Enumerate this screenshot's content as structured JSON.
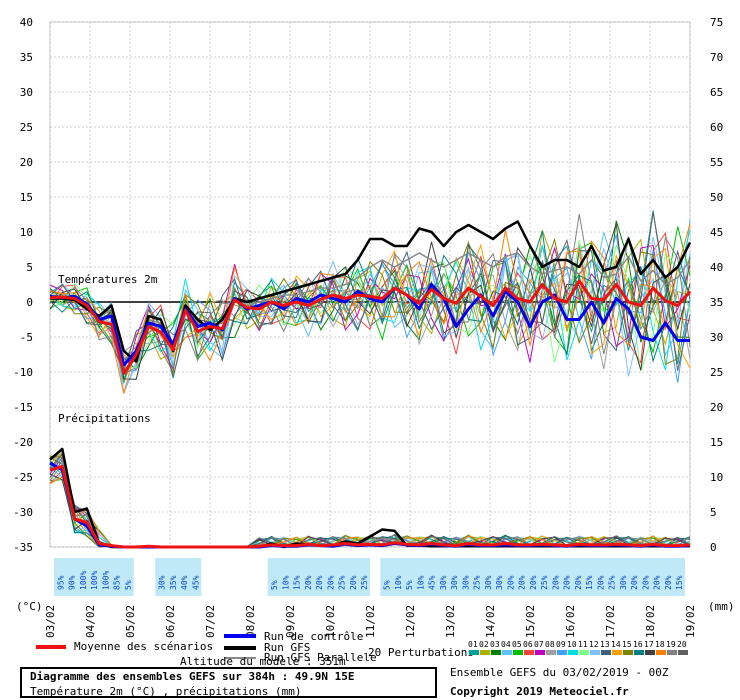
{
  "chart_data": {
    "type": "line",
    "title": "Diagramme des ensembles GEFS sur 384h : 49.9N 15E",
    "subtitle": "Température 2m (°C) , précipitations (mm)",
    "section_labels": {
      "temp": "Températures 2m",
      "precip": "Précipitations"
    },
    "left_axis_unit": "(°C)",
    "right_axis_unit": "(mm)",
    "left_ticks": [
      40,
      35,
      30,
      25,
      20,
      15,
      10,
      5,
      0,
      -5,
      -10,
      -15,
      -20,
      -25,
      -30,
      -35
    ],
    "right_ticks": [
      75,
      70,
      65,
      60,
      55,
      50,
      45,
      40,
      35,
      30,
      25,
      20,
      15,
      10,
      5,
      0
    ],
    "x_dates": [
      "03/02",
      "04/02",
      "05/02",
      "06/02",
      "07/02",
      "08/02",
      "09/02",
      "10/02",
      "11/02",
      "12/02",
      "13/02",
      "14/02",
      "15/02",
      "16/02",
      "17/02",
      "18/02",
      "19/02"
    ],
    "snow_probabilities": [
      "95%",
      "90%",
      "100%",
      "100%",
      "100%",
      "85%",
      "5%",
      "",
      "",
      "30%",
      "35%",
      "40%",
      "45%",
      "",
      "",
      "",
      "",
      "",
      "",
      "5%",
      "10%",
      "15%",
      "20%",
      "20%",
      "20%",
      "25%",
      "20%",
      "25%",
      "",
      "5%",
      "10%",
      "5%",
      "10%",
      "45%",
      "30%",
      "30%",
      "30%",
      "25%",
      "30%",
      "30%",
      "20%",
      "20%",
      "20%",
      "25%",
      "20%",
      "20%",
      "20%",
      "15%",
      "20%",
      "25%",
      "30%",
      "20%",
      "20%",
      "20%",
      "20%",
      "15%"
    ],
    "series": [
      {
        "name": "Moyenne des scénarios",
        "color": "#ee1111",
        "temp": [
          0.6,
          0.7,
          0.5,
          -0.5,
          -2.8,
          -3.2,
          -10.2,
          -7.5,
          -3.5,
          -4.3,
          -6.8,
          -1.2,
          -4.2,
          -3.5,
          -3.8,
          0.3,
          -0.8,
          -1.0,
          0.0,
          -0.5,
          0.0,
          -0.5,
          0.4,
          1.0,
          0.5,
          1.0,
          0.8,
          0.5,
          2.0,
          1.0,
          -0.2,
          1.8,
          0.5,
          -0.2,
          2.0,
          0.8,
          -0.5,
          2.0,
          0.5,
          0.0,
          2.5,
          0.5,
          0.0,
          3.0,
          0.5,
          0.3,
          2.5,
          0.0,
          -0.5,
          2.0,
          0.2,
          -0.5,
          1.5
        ],
        "precip": [
          11.0,
          11.5,
          4.0,
          3.5,
          0.5,
          0.2,
          0.0,
          0.0,
          0.1,
          0.0,
          0.0,
          0.0,
          0.0,
          0.0,
          0.0,
          0.0,
          0.0,
          0.1,
          0.3,
          0.2,
          0.2,
          0.4,
          0.2,
          0.3,
          0.5,
          0.3,
          0.4,
          0.3,
          0.6,
          0.4,
          0.3,
          0.5,
          0.3,
          0.2,
          0.5,
          0.3,
          0.3,
          0.5,
          0.3,
          0.3,
          0.4,
          0.3,
          0.2,
          0.4,
          0.3,
          0.3,
          0.4,
          0.3,
          0.2,
          0.4,
          0.2,
          0.2,
          0.3
        ]
      },
      {
        "name": "Run de contrôle",
        "color": "#0000ee",
        "temp": [
          0.8,
          0.6,
          0.8,
          -0.3,
          -2.5,
          -2.0,
          -9.0,
          -7.0,
          -3.0,
          -3.5,
          -6.0,
          -1.0,
          -3.5,
          -3.0,
          -4.0,
          0.5,
          -1.0,
          -0.5,
          0.0,
          -1.0,
          0.5,
          0.0,
          1.0,
          0.5,
          0.0,
          1.5,
          0.5,
          0.0,
          2.0,
          1.0,
          -1.0,
          2.5,
          0.5,
          -3.5,
          -1.0,
          1.0,
          -2.0,
          1.5,
          0.0,
          -3.5,
          0.0,
          1.0,
          -2.5,
          -2.5,
          0.0,
          -3.0,
          0.5,
          -1.0,
          -5.0,
          -5.5,
          -3.0,
          -5.5,
          -5.5
        ],
        "precip": [
          12.0,
          11.0,
          4.0,
          3.0,
          0.3,
          0.1,
          0.0,
          0.0,
          0.0,
          0.0,
          0.0,
          0.0,
          0.0,
          0.0,
          0.0,
          0.0,
          0.0,
          0.0,
          0.2,
          0.1,
          0.1,
          0.3,
          0.2,
          0.1,
          0.4,
          0.2,
          0.3,
          0.2,
          0.5,
          0.3,
          0.2,
          0.4,
          0.2,
          0.1,
          0.4,
          0.2,
          0.2,
          0.3,
          0.2,
          0.2,
          0.3,
          0.2,
          0.1,
          0.3,
          0.2,
          0.2,
          0.3,
          0.2,
          0.1,
          0.3,
          0.1,
          0.1,
          0.2
        ]
      },
      {
        "name": "Run GFS",
        "color": "#000000",
        "temp": [
          0.5,
          0.5,
          0.3,
          -1.0,
          -2.0,
          -0.5,
          -7.0,
          -8.5,
          -2.0,
          -2.5,
          -7.0,
          -0.5,
          -2.5,
          -4.0,
          -2.5,
          0.5,
          0.0,
          0.5,
          1.0,
          1.5,
          2.0,
          2.5,
          3.0,
          3.5,
          4.0,
          6.0,
          9.0,
          9.0,
          8.0,
          8.0,
          10.5,
          10.0,
          8.0,
          10.0,
          11.0,
          10.0,
          9.0,
          10.5,
          11.5,
          8.0,
          5.0,
          6.0,
          6.0,
          5.0,
          8.0,
          4.5,
          5.0,
          9.0,
          4.0,
          6.0,
          3.5,
          5.0,
          8.5
        ],
        "precip": [
          12.5,
          14.0,
          5.0,
          5.5,
          0.5,
          0.0,
          0.0,
          0.0,
          0.0,
          0.0,
          0.0,
          0.0,
          0.0,
          0.0,
          0.0,
          0.0,
          0.0,
          0.0,
          0.5,
          0.0,
          0.5,
          0.3,
          0.3,
          0.2,
          0.8,
          0.5,
          1.5,
          2.5,
          2.3,
          0.2,
          0.2,
          0.1,
          0.1,
          0.1,
          0.1,
          0.1,
          0.1,
          0.1,
          0.1,
          0.1,
          0.1,
          0.1,
          0.1,
          0.1,
          0.1,
          0.1,
          0.1,
          0.1,
          0.1,
          0.1,
          0.1,
          0.1,
          0.1
        ]
      },
      {
        "name": "Run GFS Parallele",
        "color": "#888888",
        "temp": [
          0.5,
          0.4,
          0.3,
          -1.0,
          -2.2,
          -1.0,
          -8.0,
          -8.0,
          -2.5,
          -3.0,
          -6.5,
          -1.0,
          -3.0,
          -3.5,
          -3.0,
          0.2,
          -0.5,
          0.0,
          0.5,
          1.0,
          1.0,
          1.5,
          2.0,
          2.0,
          2.5,
          3.5,
          5.0,
          6.0,
          5.0,
          6.0,
          7.0,
          6.0,
          5.0,
          6.0,
          7.0,
          6.0,
          5.0,
          6.5,
          7.0,
          5.0,
          4.0,
          4.5,
          5.0,
          4.0,
          6.0,
          3.5,
          4.0,
          6.5,
          3.0,
          4.5,
          2.5,
          3.5,
          6.0
        ],
        "precip": [
          11.5,
          12.5,
          4.5,
          4.5,
          0.4,
          0.0,
          0.0,
          0.0,
          0.0,
          0.0,
          0.0,
          0.0,
          0.0,
          0.0,
          0.0,
          0.0,
          0.0,
          0.0,
          0.3,
          0.1,
          0.3,
          0.2,
          0.2,
          0.2,
          0.5,
          0.3,
          0.8,
          1.2,
          1.0,
          0.2,
          0.2,
          0.1,
          0.1,
          0.1,
          0.1,
          0.1,
          0.1,
          0.1,
          0.1,
          0.1,
          0.1,
          0.1,
          0.1,
          0.1,
          0.1,
          0.1,
          0.1,
          0.1,
          0.1,
          0.1,
          0.1,
          0.1,
          0.1
        ]
      }
    ],
    "perturbations": {
      "label": "20 Perturbations",
      "count": 20,
      "colors": [
        "#00a0a0",
        "#b0b000",
        "#008000",
        "#60c0ff",
        "#00c000",
        "#ff4040",
        "#c000c0",
        "#a0a0a0",
        "#40a0ff",
        "#00e0e0",
        "#80ff80",
        "#80c0ff",
        "#406080",
        "#ffa000",
        "#808000",
        "#008080",
        "#404040",
        "#ff8000",
        "#808080",
        "#606060"
      ]
    },
    "legend": {
      "mean": "Moyenne des scénarios",
      "control": "Run de contrôle",
      "gfs": "Run GFS",
      "gfs_par": "Run GFS Parallele"
    },
    "altitude_label": "Altitude du modèle : 351m"
  },
  "footer": {
    "ensemble": "Ensemble GEFS du 03/02/2019 - 00Z",
    "copyright": "Copyright 2019 Meteociel.fr"
  }
}
